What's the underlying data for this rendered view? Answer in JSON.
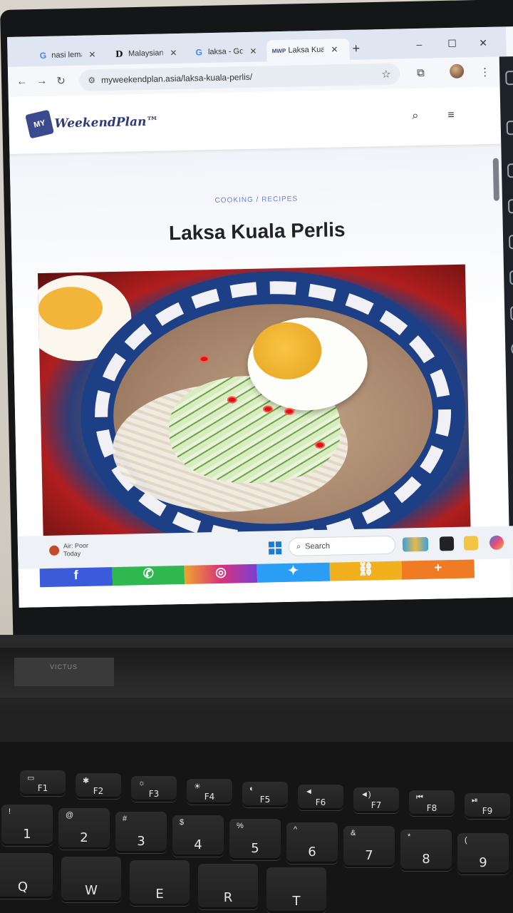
{
  "browser": {
    "tabs": [
      {
        "label": "nasi lemak",
        "favicon": "G",
        "active": false
      },
      {
        "label": "Malaysian",
        "favicon": "D",
        "active": false
      },
      {
        "label": "laksa - Go",
        "favicon": "G",
        "active": false
      },
      {
        "label": "Laksa Kua",
        "favicon": "MWP",
        "active": true
      }
    ],
    "new_tab": "+",
    "window_controls": {
      "minimize": "–",
      "maximize": "☐",
      "close": "✕"
    },
    "url": "myweekendplan.asia/laksa-kuala-perlis/"
  },
  "site": {
    "logo_badge": "MY",
    "logo_text": "WeekendPlan™",
    "category": "COOKING / RECIPES",
    "title": "Laksa Kuala Perlis"
  },
  "share_bar": [
    {
      "name": "facebook",
      "glyph": "f",
      "color": "#3b5bdb"
    },
    {
      "name": "whatsapp",
      "glyph": "✆",
      "color": "#2fb84f"
    },
    {
      "name": "instagram",
      "glyph": "◎",
      "color": "#d8337a"
    },
    {
      "name": "twitter",
      "glyph": "✦",
      "color": "#2a9df4"
    },
    {
      "name": "copy-link",
      "glyph": "⛓",
      "color": "#f2b01e"
    },
    {
      "name": "more",
      "glyph": "+",
      "color": "#ef7b24"
    }
  ],
  "taskbar": {
    "weather_line1": "Air: Poor",
    "weather_line2": "Today",
    "search_label": "Search"
  },
  "keyboard": {
    "brand": "VICTUS",
    "fn_row": [
      "F1",
      "F2",
      "F3",
      "F4",
      "F5",
      "F6",
      "F7",
      "F8",
      "F9"
    ],
    "fn_icons": [
      "▭",
      "✱",
      "☼",
      "☀",
      "◐",
      "◄",
      "◄)",
      "⏮",
      "⏯"
    ],
    "num_row": [
      {
        "main": "1",
        "top": "!"
      },
      {
        "main": "2",
        "top": "@"
      },
      {
        "main": "3",
        "top": "#"
      },
      {
        "main": "4",
        "top": "$"
      },
      {
        "main": "5",
        "top": "%"
      },
      {
        "main": "6",
        "top": "^"
      },
      {
        "main": "7",
        "top": "&"
      },
      {
        "main": "8",
        "top": "*"
      },
      {
        "main": "9",
        "top": "("
      }
    ],
    "letter_row": [
      "Q",
      "W",
      "E",
      "R",
      "T"
    ]
  }
}
